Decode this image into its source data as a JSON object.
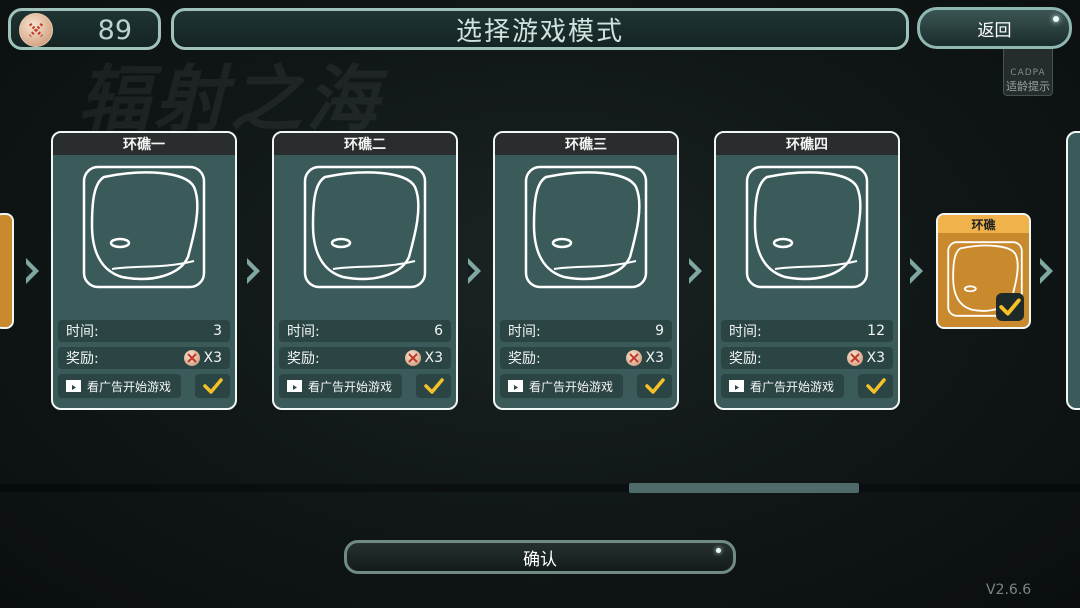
{
  "coins": {
    "count": "89",
    "icon": "coin-icon"
  },
  "header": {
    "title": "选择游戏模式",
    "back_label": "返回"
  },
  "background": {
    "watermark": "辐射之海"
  },
  "age_rating": {
    "org": "CADPA",
    "label": "适龄提示"
  },
  "cards": [
    {
      "name": "环礁一",
      "time_label": "时间:",
      "time": "3",
      "reward_label": "奖励:",
      "reward": "X3",
      "ad_label": "看广告开始游戏"
    },
    {
      "name": "环礁二",
      "time_label": "时间:",
      "time": "6",
      "reward_label": "奖励:",
      "reward": "X3",
      "ad_label": "看广告开始游戏"
    },
    {
      "name": "环礁三",
      "time_label": "时间:",
      "time": "9",
      "reward_label": "奖励:",
      "reward": "X3",
      "ad_label": "看广告开始游戏"
    },
    {
      "name": "环礁四",
      "time_label": "时间:",
      "time": "12",
      "reward_label": "奖励:",
      "reward": "X3",
      "ad_label": "看广告开始游戏"
    }
  ],
  "selected_card": {
    "name": "环礁"
  },
  "footer": {
    "confirm_label": "确认",
    "version": "V2.6.6"
  },
  "colors": {
    "accent": "#f0b24a",
    "card": "#3b5a5a",
    "check": "#f5c028"
  }
}
